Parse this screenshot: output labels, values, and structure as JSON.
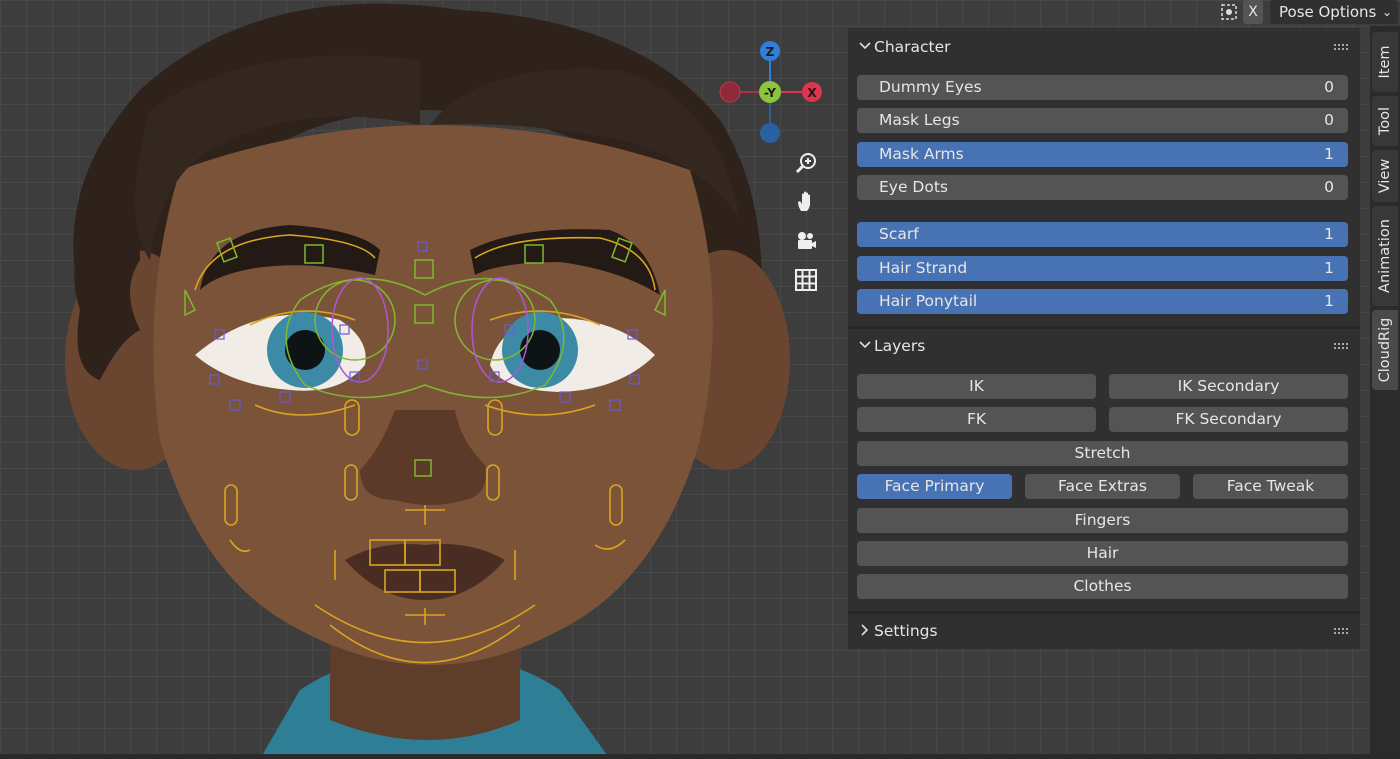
{
  "header": {
    "xray_icon": "xray-toggle-icon",
    "x_toggle_label": "X",
    "pose_options_label": "Pose Options",
    "pose_options_chevron": "chevron-down-icon"
  },
  "gizmo": {
    "z_label": "Z",
    "y_label": "-Y",
    "x_label": "X"
  },
  "tools": [
    {
      "name": "zoom-icon"
    },
    {
      "name": "pan-hand-icon"
    },
    {
      "name": "camera-icon"
    },
    {
      "name": "grid-icon"
    }
  ],
  "panel": {
    "character": {
      "title": "Character",
      "props": [
        {
          "label": "Dummy Eyes",
          "value": "0",
          "on": false
        },
        {
          "label": "Mask Legs",
          "value": "0",
          "on": false
        },
        {
          "label": "Mask Arms",
          "value": "1",
          "on": true
        },
        {
          "label": "Eye Dots",
          "value": "0",
          "on": false
        },
        {
          "label": "Scarf",
          "value": "1",
          "on": true
        },
        {
          "label": "Hair Strand",
          "value": "1",
          "on": true
        },
        {
          "label": "Hair Ponytail",
          "value": "1",
          "on": true
        }
      ]
    },
    "layers": {
      "title": "Layers",
      "buttons": {
        "ik": "IK",
        "ik_secondary": "IK Secondary",
        "fk": "FK",
        "fk_secondary": "FK Secondary",
        "stretch": "Stretch",
        "face_primary": "Face Primary",
        "face_extras": "Face Extras",
        "face_tweak": "Face Tweak",
        "fingers": "Fingers",
        "hair": "Hair",
        "clothes": "Clothes"
      },
      "active": [
        "face_primary"
      ]
    },
    "settings": {
      "title": "Settings"
    }
  },
  "side_tabs": [
    "Item",
    "Tool",
    "View",
    "Animation",
    "CloudRig"
  ],
  "active_side_tab": "CloudRig",
  "colors": {
    "accent": "#4772b3",
    "button": "#545454",
    "panel": "#303030",
    "axis_x": "#e0344e",
    "axis_y": "#8bc53f",
    "axis_z": "#2f7fd8"
  }
}
